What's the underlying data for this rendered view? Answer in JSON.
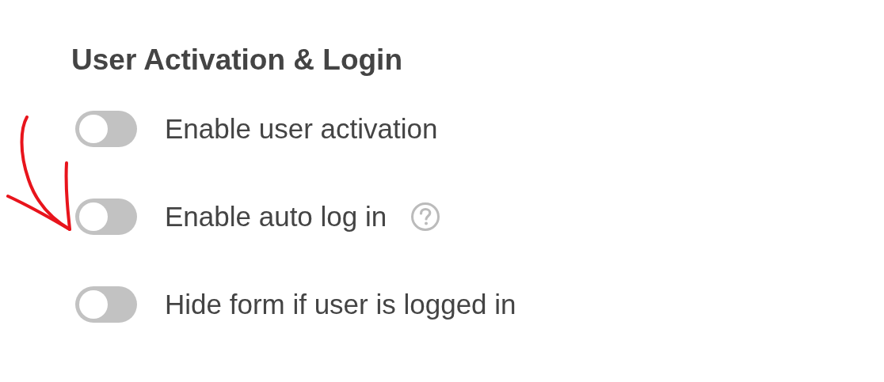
{
  "section": {
    "title": "User Activation & Login"
  },
  "settings": [
    {
      "label": "Enable user activation",
      "on": false,
      "help": false
    },
    {
      "label": "Enable auto log in",
      "on": false,
      "help": true
    },
    {
      "label": "Hide form if user is logged in",
      "on": false,
      "help": false
    }
  ]
}
